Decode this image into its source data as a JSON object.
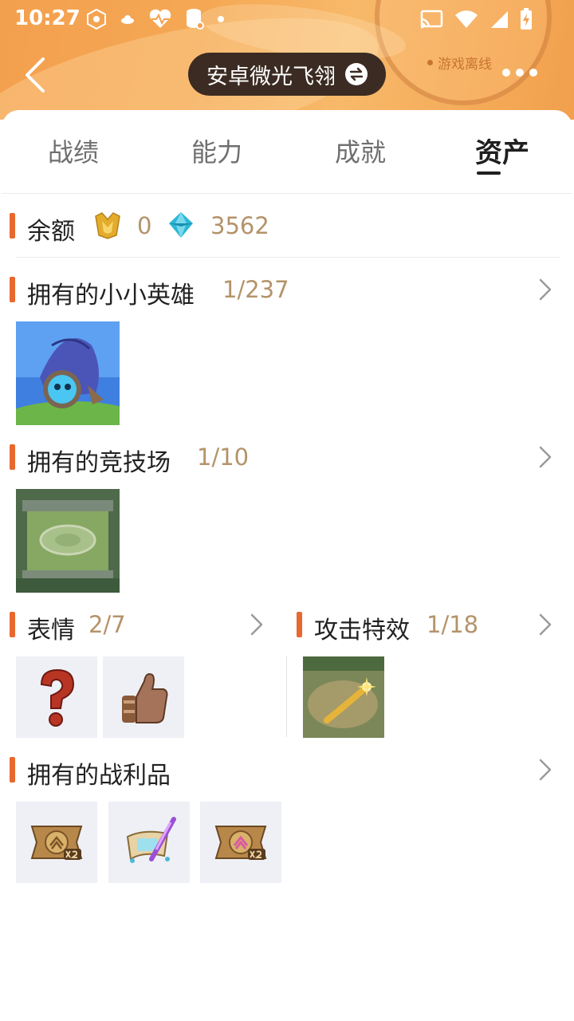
{
  "status_bar": {
    "time": "10:27"
  },
  "header": {
    "player_name": "安卓微光飞翎",
    "status_text": "游戏离线"
  },
  "tabs": [
    {
      "label": "战绩"
    },
    {
      "label": "能力"
    },
    {
      "label": "成就"
    },
    {
      "label": "资产",
      "active": true
    }
  ],
  "balance": {
    "title": "余额",
    "gold_value": "0",
    "diamond_value": "3562"
  },
  "little_legends": {
    "title": "拥有的小小英雄",
    "count": "1/237"
  },
  "arenas": {
    "title": "拥有的竞技场",
    "count": "1/10"
  },
  "emotes": {
    "title": "表情",
    "count": "2/7"
  },
  "booms": {
    "title": "攻击特效",
    "count": "1/18"
  },
  "loot": {
    "title": "拥有的战利品"
  },
  "colors": {
    "accent_bar": "#e8682d",
    "count_text": "#b4936a",
    "header_orange": "#f5a854"
  }
}
